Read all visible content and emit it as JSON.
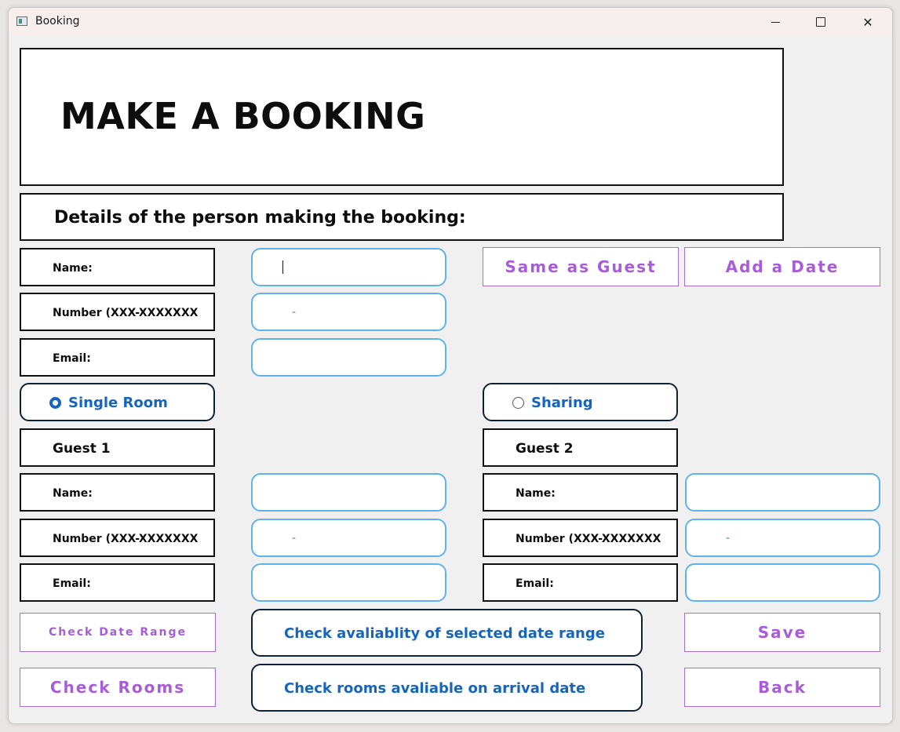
{
  "window": {
    "title": "Booking",
    "min_symbol": "",
    "close_symbol": "✕"
  },
  "header": {
    "title": "MAKE A BOOKING"
  },
  "details": {
    "heading": "Details of the person making the booking:"
  },
  "booker": {
    "name_label": "Name:",
    "number_label": "Number (XXX-XXXXXXX",
    "email_label": "Email:",
    "name_value": "",
    "number_value": "-",
    "email_value": ""
  },
  "buttons": {
    "same_as_guest": "Same as Guest",
    "add_a_date": "Add a Date",
    "check_date_range": "Check Date Range",
    "check_rooms": "Check Rooms",
    "save": "Save",
    "back": "Back"
  },
  "room_type": {
    "single": "Single Room",
    "sharing": "Sharing",
    "selected": "Single Room"
  },
  "guest1": {
    "title": "Guest 1",
    "name_label": "Name:",
    "number_label": "Number (XXX-XXXXXXX",
    "email_label": "Email:",
    "name_value": "",
    "number_value": "-",
    "email_value": ""
  },
  "guest2": {
    "title": "Guest 2",
    "name_label": "Name:",
    "number_label": "Number (XXX-XXXXXXX",
    "email_label": "Email:",
    "name_value": "",
    "number_value": "-",
    "email_value": ""
  },
  "actions": {
    "check_availability": "Check avaliablity of selected date range",
    "check_rooms_arrival": "Check rooms avaliable on arrival date"
  },
  "colors": {
    "accent_blue": "#1565c0",
    "input_border": "#5fb3ea",
    "purple": "#a85cd9"
  }
}
